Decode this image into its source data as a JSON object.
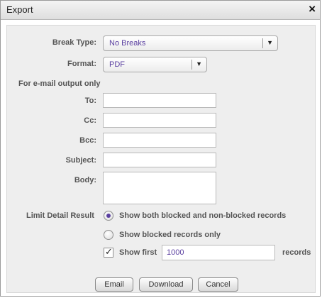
{
  "dialog": {
    "title": "Export",
    "close_glyph": "×"
  },
  "form": {
    "break_type": {
      "label": "Break Type:",
      "value": "No Breaks"
    },
    "format": {
      "label": "Format:",
      "value": "PDF"
    },
    "email_section_label": "For e-mail output only",
    "to": {
      "label": "To:",
      "value": ""
    },
    "cc": {
      "label": "Cc:",
      "value": ""
    },
    "bcc": {
      "label": "Bcc:",
      "value": ""
    },
    "subject": {
      "label": "Subject:",
      "value": ""
    },
    "body": {
      "label": "Body:",
      "value": ""
    },
    "limit": {
      "label": "Limit Detail Result",
      "options": [
        {
          "label": "Show both blocked and non-blocked records",
          "selected": true
        },
        {
          "label": "Show blocked records only",
          "selected": false
        }
      ],
      "show_first": {
        "label": "Show first",
        "checked": true,
        "value": "1000",
        "suffix": "records"
      }
    }
  },
  "buttons": {
    "email": "Email",
    "download": "Download",
    "cancel": "Cancel"
  },
  "icons": {
    "dropdown": "chevron-down-icon",
    "close": "close-icon",
    "check": "checkmark-icon"
  },
  "colors": {
    "accent": "#5a3fa0"
  }
}
